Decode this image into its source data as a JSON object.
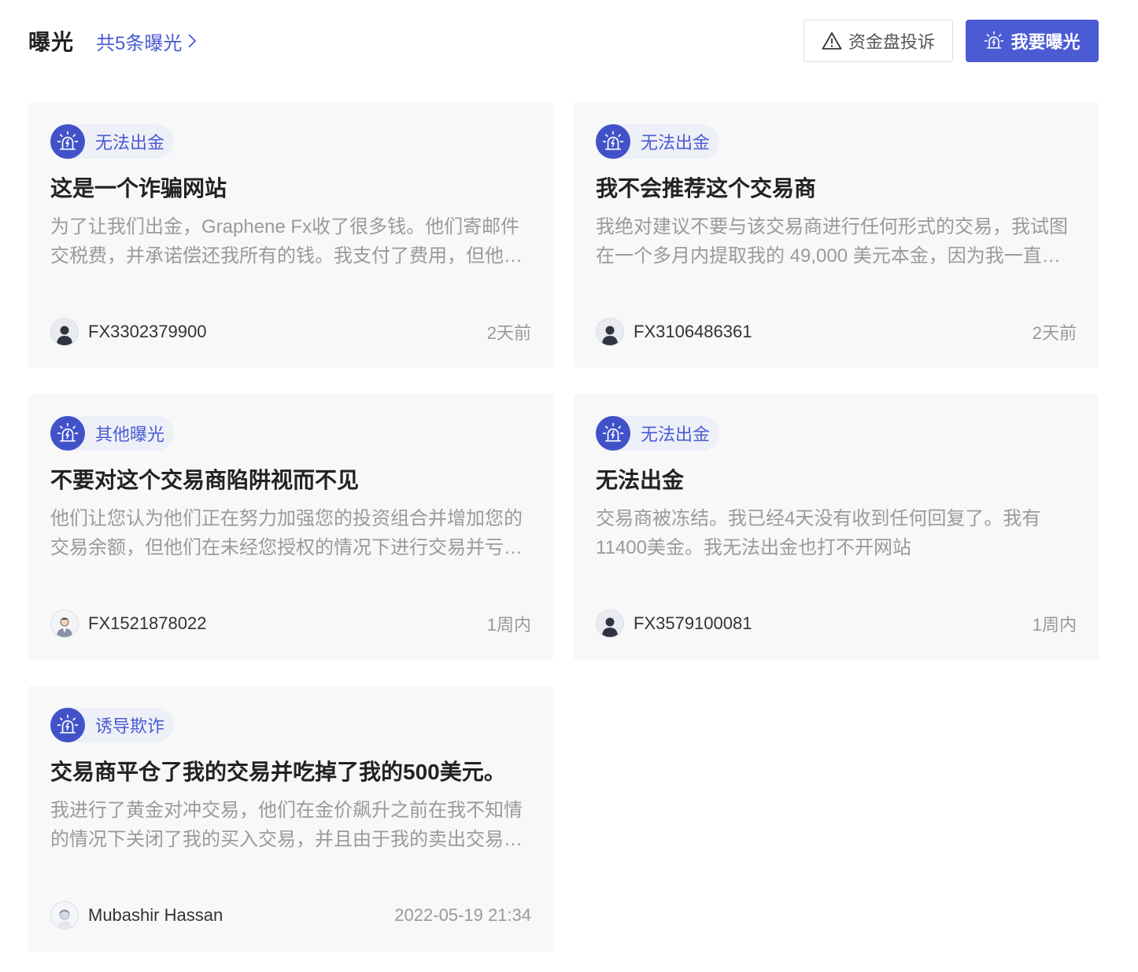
{
  "header": {
    "title": "曝光",
    "count_link": "共5条曝光",
    "complain_button": "资金盘投诉",
    "expose_button": "我要曝光"
  },
  "colors": {
    "accent": "#4a5bd4",
    "card_bg": "#f8f8f9",
    "tag_bg": "#eef0f7",
    "body_text": "#9a9a9a"
  },
  "cards": [
    {
      "tag": "无法出金",
      "title": "这是一个诈骗网站",
      "body": "为了让我们出金，Graphene Fx收了很多钱。他们寄邮件交税费，并承诺偿还我所有的钱。我支付了费用，但他们却没有给我任何回复。",
      "author": "FX3302379900",
      "time": "2天前",
      "avatar_icon": "user-silhouette-icon"
    },
    {
      "tag": "无法出金",
      "title": "我不会推荐这个交易商",
      "body": "我绝对建议不要与该交易商进行任何形式的交易，我试图在一个多月内提取我的 49,000 美元本金，因为我一直没有收到任何回应。",
      "author": "FX3106486361",
      "time": "2天前",
      "avatar_icon": "user-silhouette-icon"
    },
    {
      "tag": "其他曝光",
      "title": "不要对这个交易商陷阱视而不见",
      "body": "他们让您认为他们正在努力加强您的投资组合并增加您的交易余额，但他们在未经您授权的情况下进行交易并亏损了您的资金。",
      "author": "FX1521878022",
      "time": "1周内",
      "avatar_icon": "user-suit-icon"
    },
    {
      "tag": "无法出金",
      "title": "无法出金",
      "body": "交易商被冻结。我已经4天没有收到任何回复了。我有11400美金。我无法出金也打不开网站",
      "author": "FX3579100081",
      "time": "1周内",
      "avatar_icon": "user-silhouette-icon"
    },
    {
      "tag": "诱导欺诈",
      "title": "交易商平仓了我的交易并吃掉了我的500美元。",
      "body": "我进行了黄金对冲交易，他们在金价飙升之前在我不知情的情况下关闭了我的买入交易，并且由于我的卖出交易也被平仓，我损失了全部资金。",
      "author": "Mubashir Hassan",
      "time": "2022-05-19 21:34",
      "avatar_icon": "user-photo-icon"
    }
  ]
}
